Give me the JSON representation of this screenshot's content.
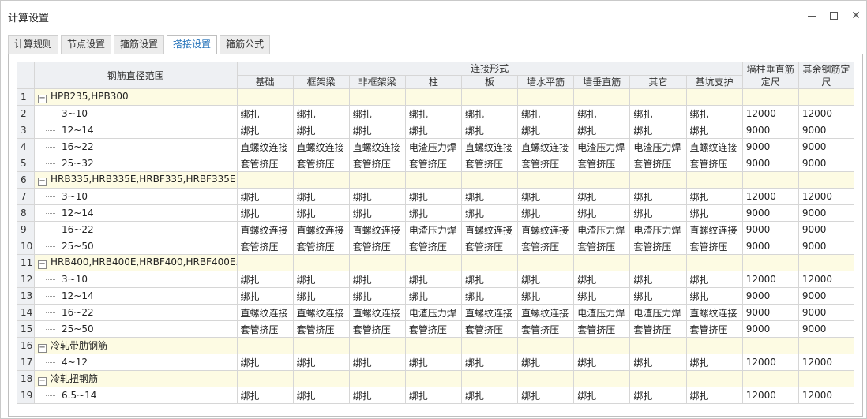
{
  "window": {
    "title": "计算设置"
  },
  "tabs": [
    "计算规则",
    "节点设置",
    "箍筋设置",
    "搭接设置",
    "箍筋公式"
  ],
  "active_tab": 3,
  "table": {
    "range_header": "钢筋直径范围",
    "connection_header": "连接形式",
    "connection_columns": [
      "基础",
      "框架梁",
      "非框架梁",
      "柱",
      "板",
      "墙水平筋",
      "墙垂直筋",
      "其它",
      "基坑支护"
    ],
    "wall_fixed_header": "墙柱垂直筋定尺",
    "other_fixed_header": "其余钢筋定尺",
    "rows": [
      {
        "num": "1",
        "group": true,
        "name": "HPB235,HPB300",
        "cells": [
          "",
          "",
          "",
          "",
          "",
          "",
          "",
          "",
          "",
          "",
          ""
        ]
      },
      {
        "num": "2",
        "group": false,
        "name": "3~10",
        "cells": [
          "绑扎",
          "绑扎",
          "绑扎",
          "绑扎",
          "绑扎",
          "绑扎",
          "绑扎",
          "绑扎",
          "绑扎",
          "12000",
          "12000"
        ]
      },
      {
        "num": "3",
        "group": false,
        "name": "12~14",
        "cells": [
          "绑扎",
          "绑扎",
          "绑扎",
          "绑扎",
          "绑扎",
          "绑扎",
          "绑扎",
          "绑扎",
          "绑扎",
          "9000",
          "9000"
        ]
      },
      {
        "num": "4",
        "group": false,
        "name": "16~22",
        "cells": [
          "直螺纹连接",
          "直螺纹连接",
          "直螺纹连接",
          "电渣压力焊",
          "直螺纹连接",
          "直螺纹连接",
          "电渣压力焊",
          "电渣压力焊",
          "直螺纹连接",
          "9000",
          "9000"
        ]
      },
      {
        "num": "5",
        "group": false,
        "name": "25~32",
        "cells": [
          "套管挤压",
          "套管挤压",
          "套管挤压",
          "套管挤压",
          "套管挤压",
          "套管挤压",
          "套管挤压",
          "套管挤压",
          "套管挤压",
          "9000",
          "9000"
        ]
      },
      {
        "num": "6",
        "group": true,
        "name": "HRB335,HRB335E,HRBF335,HRBF335E",
        "cells": [
          "",
          "",
          "",
          "",
          "",
          "",
          "",
          "",
          "",
          "",
          ""
        ]
      },
      {
        "num": "7",
        "group": false,
        "name": "3~10",
        "cells": [
          "绑扎",
          "绑扎",
          "绑扎",
          "绑扎",
          "绑扎",
          "绑扎",
          "绑扎",
          "绑扎",
          "绑扎",
          "12000",
          "12000"
        ]
      },
      {
        "num": "8",
        "group": false,
        "name": "12~14",
        "cells": [
          "绑扎",
          "绑扎",
          "绑扎",
          "绑扎",
          "绑扎",
          "绑扎",
          "绑扎",
          "绑扎",
          "绑扎",
          "9000",
          "9000"
        ]
      },
      {
        "num": "9",
        "group": false,
        "name": "16~22",
        "cells": [
          "直螺纹连接",
          "直螺纹连接",
          "直螺纹连接",
          "电渣压力焊",
          "直螺纹连接",
          "直螺纹连接",
          "电渣压力焊",
          "电渣压力焊",
          "直螺纹连接",
          "9000",
          "9000"
        ]
      },
      {
        "num": "10",
        "group": false,
        "name": "25~50",
        "cells": [
          "套管挤压",
          "套管挤压",
          "套管挤压",
          "套管挤压",
          "套管挤压",
          "套管挤压",
          "套管挤压",
          "套管挤压",
          "套管挤压",
          "9000",
          "9000"
        ]
      },
      {
        "num": "11",
        "group": true,
        "name": "HRB400,HRB400E,HRBF400,HRBF400E...",
        "cells": [
          "",
          "",
          "",
          "",
          "",
          "",
          "",
          "",
          "",
          "",
          ""
        ]
      },
      {
        "num": "12",
        "group": false,
        "name": "3~10",
        "cells": [
          "绑扎",
          "绑扎",
          "绑扎",
          "绑扎",
          "绑扎",
          "绑扎",
          "绑扎",
          "绑扎",
          "绑扎",
          "12000",
          "12000"
        ]
      },
      {
        "num": "13",
        "group": false,
        "name": "12~14",
        "cells": [
          "绑扎",
          "绑扎",
          "绑扎",
          "绑扎",
          "绑扎",
          "绑扎",
          "绑扎",
          "绑扎",
          "绑扎",
          "9000",
          "9000"
        ]
      },
      {
        "num": "14",
        "group": false,
        "name": "16~22",
        "cells": [
          "直螺纹连接",
          "直螺纹连接",
          "直螺纹连接",
          "电渣压力焊",
          "直螺纹连接",
          "直螺纹连接",
          "电渣压力焊",
          "电渣压力焊",
          "直螺纹连接",
          "9000",
          "9000"
        ]
      },
      {
        "num": "15",
        "group": false,
        "name": "25~50",
        "cells": [
          "套管挤压",
          "套管挤压",
          "套管挤压",
          "套管挤压",
          "套管挤压",
          "套管挤压",
          "套管挤压",
          "套管挤压",
          "套管挤压",
          "9000",
          "9000"
        ]
      },
      {
        "num": "16",
        "group": true,
        "name": "冷轧带肋钢筋",
        "cells": [
          "",
          "",
          "",
          "",
          "",
          "",
          "",
          "",
          "",
          "",
          ""
        ]
      },
      {
        "num": "17",
        "group": false,
        "name": "4~12",
        "cells": [
          "绑扎",
          "绑扎",
          "绑扎",
          "绑扎",
          "绑扎",
          "绑扎",
          "绑扎",
          "绑扎",
          "绑扎",
          "12000",
          "12000"
        ]
      },
      {
        "num": "18",
        "group": true,
        "name": "冷轧扭钢筋",
        "cells": [
          "",
          "",
          "",
          "",
          "",
          "",
          "",
          "",
          "",
          "",
          ""
        ]
      },
      {
        "num": "19",
        "group": false,
        "name": "6.5~14",
        "cells": [
          "绑扎",
          "绑扎",
          "绑扎",
          "绑扎",
          "绑扎",
          "绑扎",
          "绑扎",
          "绑扎",
          "绑扎",
          "12000",
          "12000"
        ]
      }
    ]
  },
  "colors": {
    "active_tab_text": "#1f6fb8",
    "group_row_bg": "#fdfbe3",
    "header_bg": "#eef0f3"
  }
}
